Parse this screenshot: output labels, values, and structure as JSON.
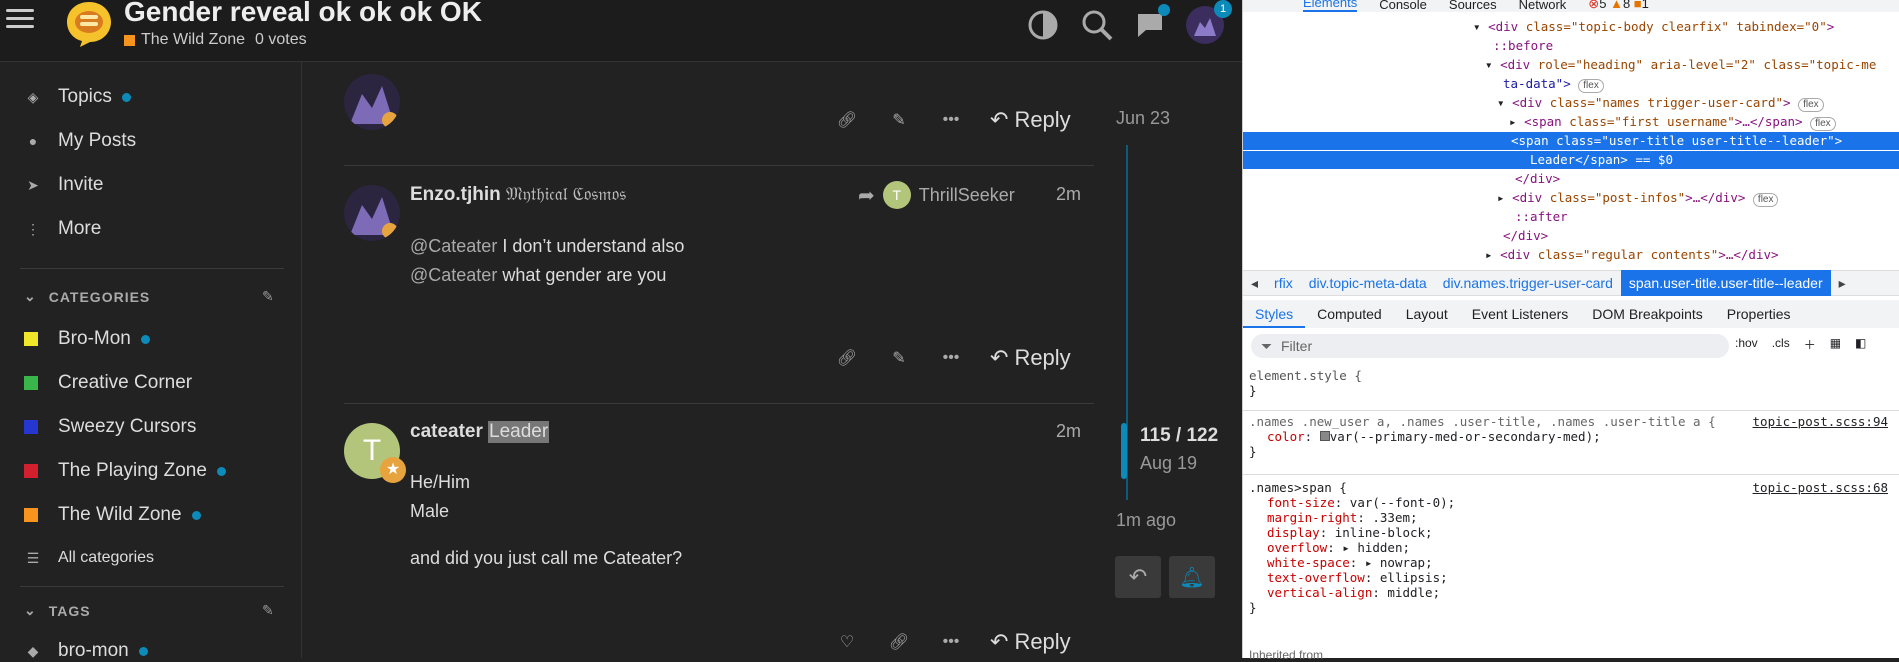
{
  "header": {
    "title": "Gender reveal ok ok ok OK",
    "category": "The Wild Zone",
    "votes": "0 votes",
    "category_color": "#f7941d",
    "notification_count": "1"
  },
  "sidebar": {
    "items": [
      {
        "label": "Topics",
        "icon": "layers-icon"
      },
      {
        "label": "My Posts",
        "icon": "user-icon"
      },
      {
        "label": "Invite",
        "icon": "paper-plane-icon"
      },
      {
        "label": "More",
        "icon": "more-vertical-icon"
      }
    ],
    "categories_heading": "CATEGORIES",
    "categories": [
      {
        "label": "Bro-Mon",
        "color": "#f0e62a"
      },
      {
        "label": "Creative Corner",
        "color": "#3ab54a"
      },
      {
        "label": "Sweezy Cursors",
        "color": "#2537d0"
      },
      {
        "label": "The Playing Zone",
        "color": "#d3202f"
      },
      {
        "label": "The Wild Zone",
        "color": "#f7941d"
      }
    ],
    "all_categories": "All categories",
    "tags_heading": "TAGS",
    "tags": [
      {
        "label": "bro-mon"
      }
    ]
  },
  "posts": [
    {
      "reply_label": "Reply",
      "date": "Jun 23"
    },
    {
      "username": "Enzo.tjhin",
      "flair": "𝔐𝔶𝔱𝔥𝔦𝔠𝔞𝔩 ℭ𝔬𝔰𝔪𝔬𝔰",
      "reply_to": "ThrillSeeker",
      "reply_to_initial": "T",
      "time": "2m",
      "line1_mention": "@Cateater",
      "line1_text": " I don’t understand also",
      "line2_mention": "@Cateater",
      "line2_text": " what gender are you",
      "reply_label": "Reply"
    },
    {
      "username": "cateater",
      "title": "Leader",
      "avatar_initial": "T",
      "time": "2m",
      "line1": "He/Him",
      "line2": "Male",
      "line3": "and did you just call me Cateater?",
      "reply_label": "Reply"
    }
  ],
  "timeline": {
    "progress": "115 / 122",
    "date": "Aug 19",
    "ago": "1m ago",
    "position_fraction": 0.94
  },
  "devtools": {
    "tabs": [
      "Elements",
      "Console",
      "Sources",
      "Network"
    ],
    "errors": "5",
    "warnings": "8",
    "info": "1",
    "dom": [
      {
        "indent": "",
        "pre": "▾ ",
        "tag": "div",
        "attrs": " class=\"topic-body clearfix\" tabindex=\"0\"",
        "post": ">",
        "pill": ""
      },
      {
        "indent": "",
        "pre": "  ",
        "tag": "",
        "attrs": "::before",
        "post": "",
        "pill": ""
      },
      {
        "indent": "",
        "pre": "▾ ",
        "tag": "div",
        "attrs": " role=\"heading\" aria-level=\"2\" class=\"topic-me",
        "post": "",
        "pill": ""
      },
      {
        "indent": "",
        "pre": "  ",
        "tag": "",
        "attrs": "ta-data\">",
        "post": "",
        "pill": "flex"
      },
      {
        "indent": "",
        "pre": "▾ ",
        "tag": "div",
        "attrs": " class=\"names trigger-user-card\"",
        "post": ">",
        "pill": "flex"
      },
      {
        "indent": "",
        "pre": "▸ ",
        "tag": "span",
        "attrs": " class=\"first username\"",
        "post": ">…</span>",
        "pill": "flex"
      },
      {
        "indent": "",
        "pre": "  ",
        "tag": "span",
        "attrs": " class=\"user-title user-title--leader\"",
        "post": ">",
        "pill": "",
        "selected": true
      },
      {
        "indent": "",
        "pre": "  ",
        "tag": "",
        "attrs": "Leader</span> == $0",
        "post": "",
        "pill": "",
        "selected": true
      },
      {
        "indent": "",
        "pre": "  ",
        "tag": "",
        "attrs": "</div>",
        "post": "",
        "pill": ""
      },
      {
        "indent": "",
        "pre": "▸ ",
        "tag": "div",
        "attrs": " class=\"post-infos\"",
        "post": ">…</div>",
        "pill": "flex"
      },
      {
        "indent": "",
        "pre": "  ",
        "tag": "",
        "attrs": "::after",
        "post": "",
        "pill": ""
      },
      {
        "indent": "",
        "pre": "  ",
        "tag": "",
        "attrs": "</div>",
        "post": "",
        "pill": ""
      },
      {
        "indent": "",
        "pre": "▸ ",
        "tag": "div",
        "attrs": " class=\"regular contents\"",
        "post": ">…</div>",
        "pill": ""
      }
    ],
    "breadcrumbs": [
      "rfix",
      "div.topic-meta-data",
      "div.names.trigger-user-card",
      "span.user-title.user-title--leader"
    ],
    "style_tabs": [
      "Styles",
      "Computed",
      "Layout",
      "Event Listeners",
      "DOM Breakpoints",
      "Properties"
    ],
    "filter_placeholder": "Filter",
    "hov": ":hov",
    "cls": ".cls",
    "rules": [
      {
        "selector": "element.style {",
        "props": [],
        "source": ""
      },
      {
        "selector": ".names .new_user a, .names .user-title, .names .user-title a {",
        "props": [
          {
            "name": "color",
            "value": "var(--primary-med-or-secondary-med);"
          }
        ],
        "source": "topic-post.scss:94"
      },
      {
        "selector": ".names>span {",
        "props": [
          {
            "name": "font-size",
            "value": "var(--font-0);"
          },
          {
            "name": "margin-right",
            "value": ".33em;"
          },
          {
            "name": "display",
            "value": "inline-block;"
          },
          {
            "name": "overflow",
            "value": "▸ hidden;"
          },
          {
            "name": "white-space",
            "value": "▸ nowrap;"
          },
          {
            "name": "text-overflow",
            "value": "ellipsis;"
          },
          {
            "name": "vertical-align",
            "value": "middle;"
          }
        ],
        "source": "topic-post.scss:68"
      }
    ],
    "inherited": "Inherited from "
  }
}
